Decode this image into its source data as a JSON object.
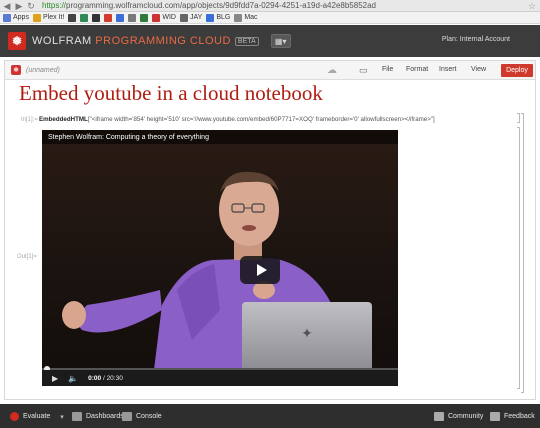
{
  "browser": {
    "url_scheme": "https://",
    "url_rest": "programming.wolframcloud.com/app/objects/9d9fdd7a-0294-4251-a19d-a42e8b5852ad",
    "bookmarks": [
      {
        "label": "Apps",
        "color": "#5a7bd6"
      },
      {
        "label": "Plex It!",
        "color": "#e0a21a"
      },
      {
        "label": "",
        "color": "#444444"
      },
      {
        "label": "",
        "color": "#2e8b57"
      },
      {
        "label": "",
        "color": "#333333"
      },
      {
        "label": "",
        "color": "#d43a2a"
      },
      {
        "label": "",
        "color": "#3a6fd8"
      },
      {
        "label": "",
        "color": "#7a7a7a"
      },
      {
        "label": "",
        "color": "#2d7a3a"
      },
      {
        "label": "WID",
        "color": "#cc3333"
      },
      {
        "label": "JAY",
        "color": "#666666"
      },
      {
        "label": "BLG",
        "color": "#3a6fd8"
      },
      {
        "label": "Mac",
        "color": "#888888"
      }
    ]
  },
  "app": {
    "brand_main": "WOLFRAM",
    "brand_accent": "PROGRAMMING CLOUD",
    "beta": "BETA",
    "plan": "Plan: Internal Account"
  },
  "notebook": {
    "name": "(unnamed)",
    "menu": [
      "File",
      "Format",
      "Insert",
      "View"
    ],
    "deploy": "Deploy",
    "title": "Embed youtube in a cloud notebook",
    "in_label": "In[1]:=",
    "out_label": "Out[1]=",
    "code_fn": "EmbeddedHTML",
    "code_arg": "[\"<iframe width='854' height='510' src='//www.youtube.com/embed/60P7717=XOQ' frameborder='0' allowfullscreen></iframe>\"]"
  },
  "video": {
    "title": "Stephen Wolfram: Computing a theory of everything",
    "current_time": "0:00",
    "duration": "20:30",
    "progress": 0
  },
  "bottom_bar": {
    "evaluate": "Evaluate",
    "dashboards": "Dashboards",
    "console": "Console",
    "community": "Community",
    "feedback": "Feedback"
  },
  "colors": {
    "brand_red": "#d12b20",
    "title_red": "#b01d12",
    "header_bg": "#3c3c3c"
  }
}
